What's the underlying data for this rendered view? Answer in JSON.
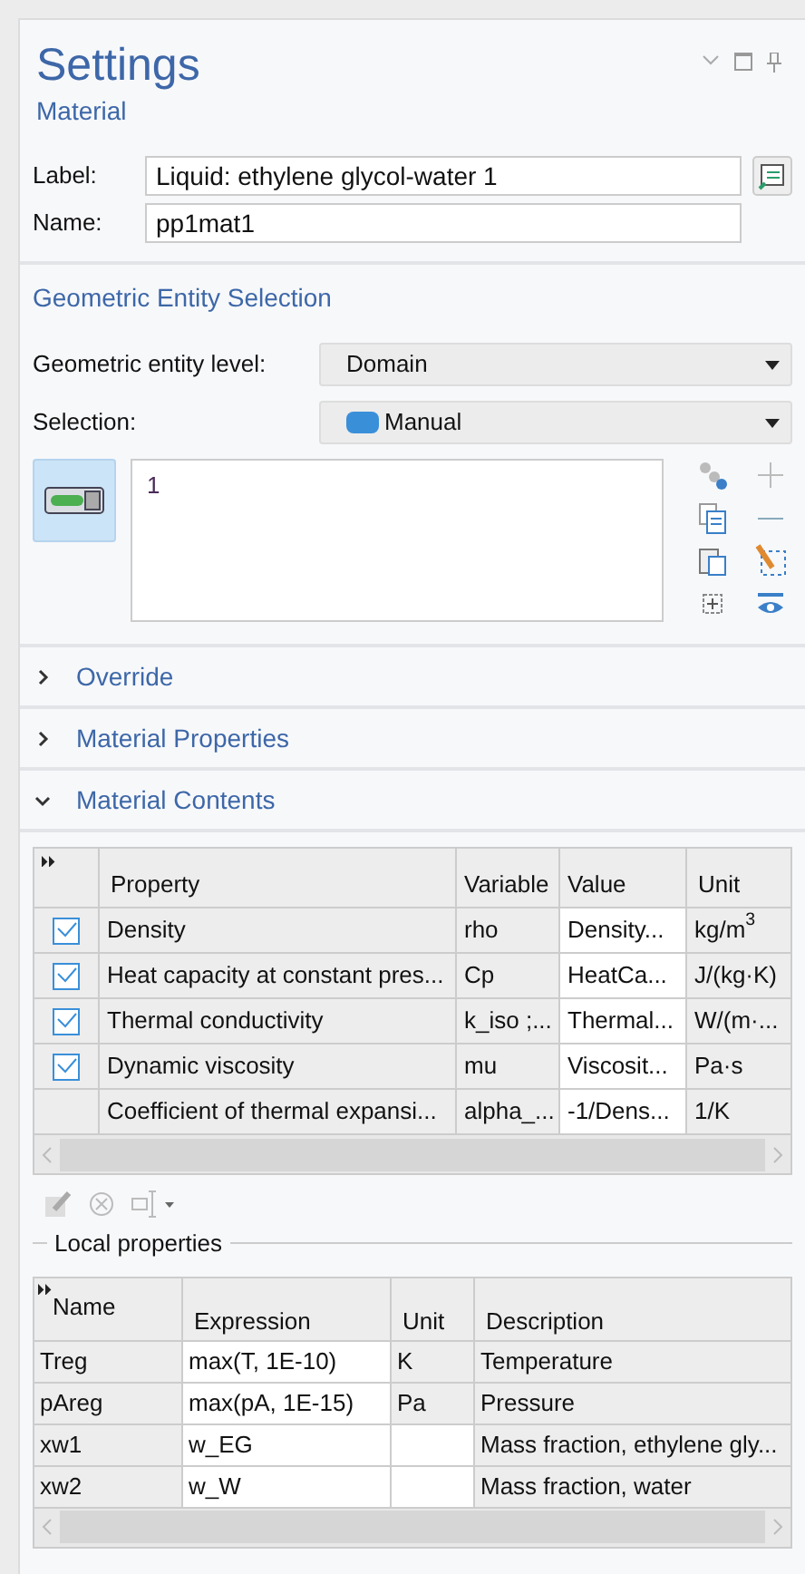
{
  "header": {
    "title": "Settings",
    "subtitle": "Material"
  },
  "label_field": {
    "label": "Label:",
    "value": "Liquid: ethylene glycol-water 1"
  },
  "name_field": {
    "label": "Name:",
    "value": "pp1mat1"
  },
  "geometric_entity_selection": {
    "title": "Geometric Entity Selection",
    "level_label": "Geometric entity level:",
    "level_value": "Domain",
    "selection_label": "Selection:",
    "selection_value": "Manual",
    "active": true,
    "entities": [
      "1"
    ]
  },
  "sections": [
    {
      "title": "Override",
      "expanded": false
    },
    {
      "title": "Material Properties",
      "expanded": false
    },
    {
      "title": "Material Contents",
      "expanded": true
    }
  ],
  "contents_table": {
    "columns": [
      "Property",
      "Variable",
      "Value",
      "Unit"
    ],
    "rows": [
      {
        "checked": true,
        "cells": [
          "Density",
          "rho",
          "Density...",
          "kg/m$^{3}$"
        ]
      },
      {
        "checked": true,
        "cells": [
          "Heat capacity at constant pres...",
          "Cp",
          "HeatCa...",
          "J/(kg·K)"
        ]
      },
      {
        "checked": true,
        "cells": [
          "Thermal conductivity",
          "k_iso ;...",
          "Thermal...",
          "W/(m·..."
        ]
      },
      {
        "checked": true,
        "cells": [
          "Dynamic viscosity",
          "mu",
          "Viscosit...",
          "Pa·s"
        ]
      },
      {
        "checked": false,
        "cells": [
          "Coefficient of thermal expansi...",
          "alpha_...",
          "-1/Dens...",
          "1/K"
        ]
      }
    ]
  },
  "local_properties": {
    "title": "Local properties",
    "columns": [
      "Name",
      "Expression",
      "Unit",
      "Description"
    ],
    "rows": [
      [
        "Treg",
        "max(T, 1E-10)",
        "K",
        "Temperature"
      ],
      [
        "pAreg",
        "max(pA, 1E-15)",
        "Pa",
        "Pressure"
      ],
      [
        "xw1",
        "w_EG",
        "",
        "Mass fraction, ethylene gly..."
      ],
      [
        "xw2",
        "w_W",
        "",
        "Mass fraction, water"
      ]
    ]
  }
}
